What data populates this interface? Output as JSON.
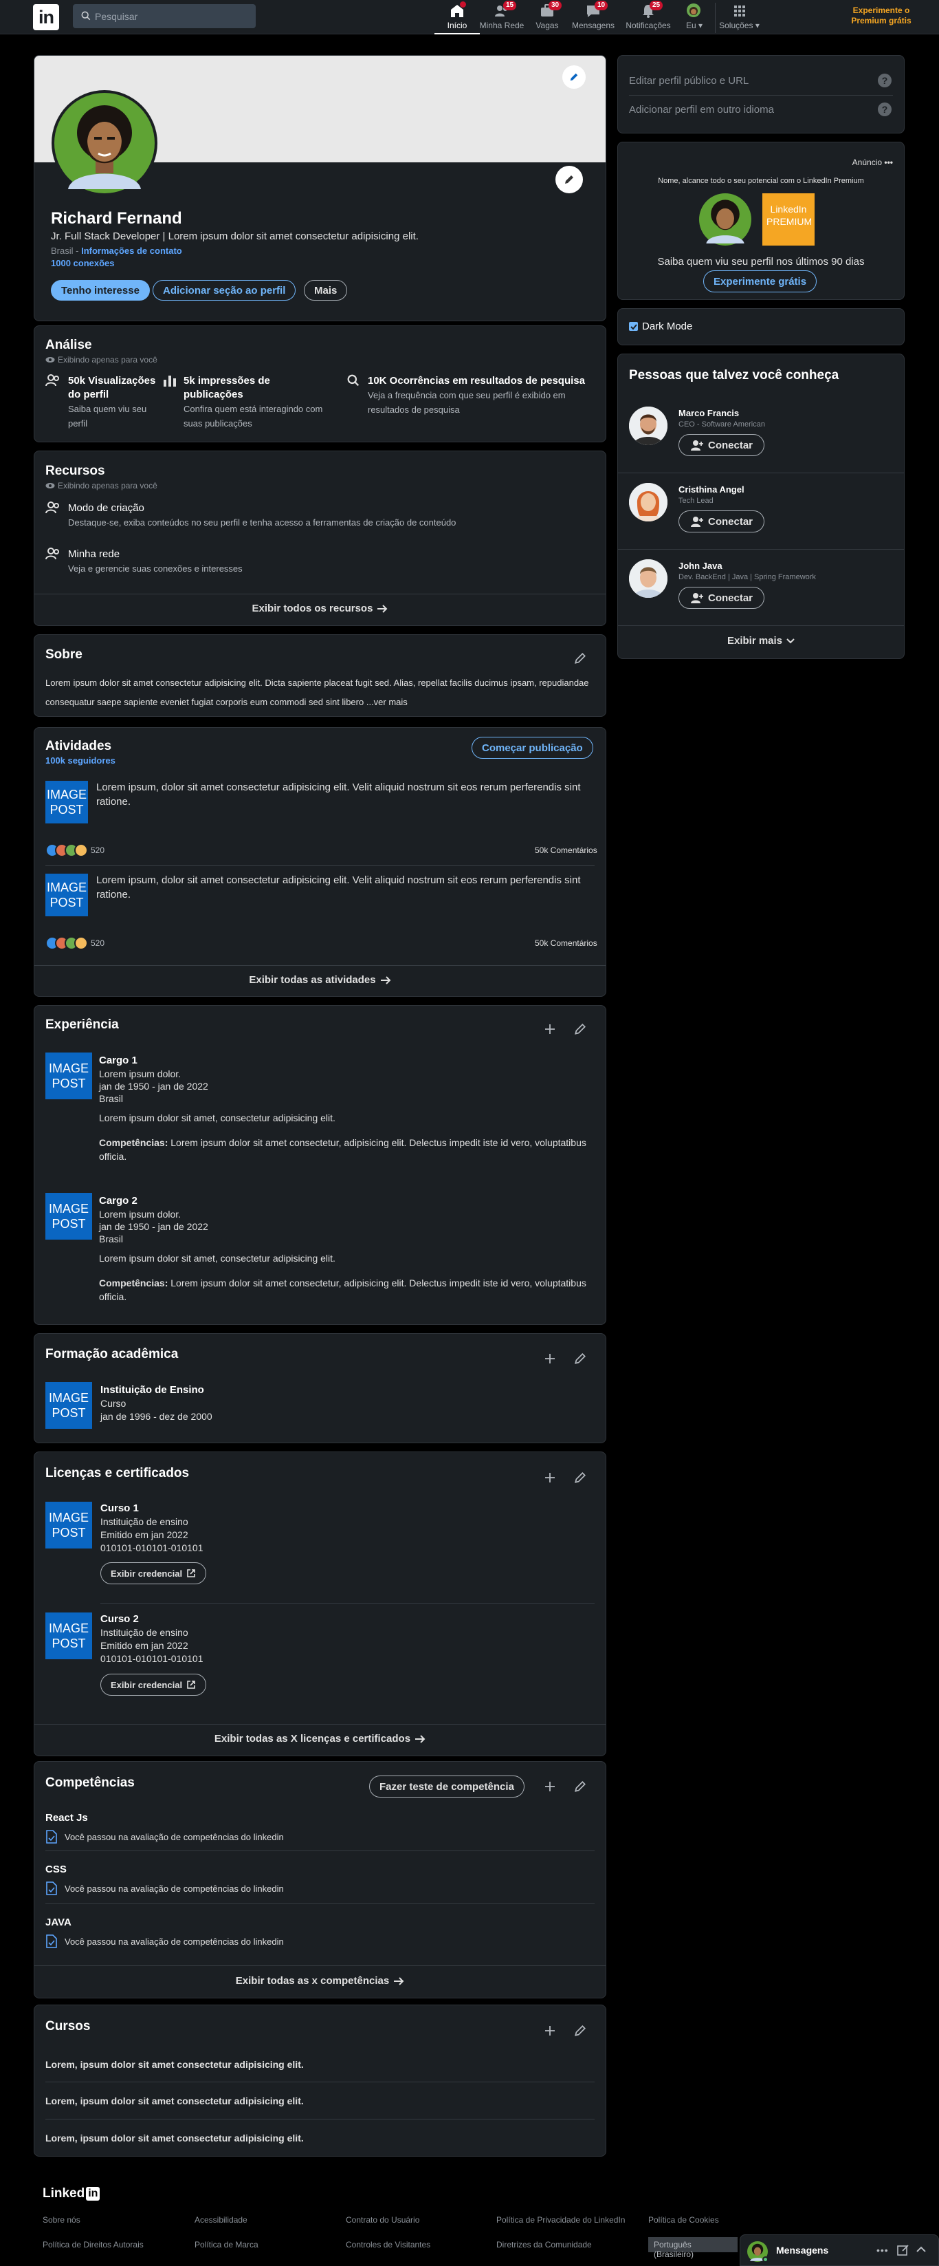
{
  "nav": {
    "logo": "in",
    "search_placeholder": "Pesquisar",
    "items": [
      {
        "label": "Início",
        "badge": ""
      },
      {
        "label": "Minha Rede",
        "badge": "15"
      },
      {
        "label": "Vagas",
        "badge": "30"
      },
      {
        "label": "Mensagens",
        "badge": "10"
      },
      {
        "label": "Notificações",
        "badge": "25"
      },
      {
        "label": "Eu ▾",
        "badge": ""
      },
      {
        "label": "Soluções ▾",
        "badge": ""
      }
    ],
    "promo": "Experimente o Premium grátis"
  },
  "profile": {
    "name": "Richard Fernand",
    "headline": "Jr. Full Stack Developer | Lorem ipsum dolor sit amet consectetur adipisicing elit.",
    "location": "Brasil",
    "sep": " - ",
    "contact_link": "Informações de contato",
    "connections": "1000 conexões",
    "btn_interest": "Tenho interesse",
    "btn_add_section": "Adicionar seção ao perfil",
    "btn_more": "Mais"
  },
  "analysis": {
    "title": "Análise",
    "private": "Exibindo apenas para você",
    "items": [
      {
        "title": "50k Visualizações do perfil",
        "desc": "Saiba quem viu seu perfil"
      },
      {
        "title": "5k impressões de publicações",
        "desc": "Confira quem está interagindo com suas publicações"
      },
      {
        "title": "10K Ocorrências em resultados de pesquisa",
        "desc": "Veja a frequência com que seu perfil é exibido em resultados de pesquisa"
      }
    ]
  },
  "resources": {
    "title": "Recursos",
    "private": "Exibindo apenas para você",
    "items": [
      {
        "title": "Modo de criação",
        "desc": "Destaque-se, exiba conteúdos no seu perfil e tenha acesso a ferramentas de criação de conteúdo"
      },
      {
        "title": "Minha rede",
        "desc": "Veja e gerencie suas conexões e interesses"
      }
    ],
    "footer": "Exibir todos os recursos"
  },
  "about": {
    "title": "Sobre",
    "text": "Lorem ipsum dolor sit amet consectetur adipisicing elit. Dicta sapiente placeat fugit sed. Alias, repellat facilis ducimus ipsam, repudiandae consequatur saepe sapiente eveniet fugiat corporis eum commodi sed sint libero ",
    "more": "...ver mais"
  },
  "activities": {
    "title": "Atividades",
    "followers": "100k seguidores",
    "btn": "Começar publicação",
    "image_text": "IMAGE POST",
    "posts": [
      {
        "text": "Lorem ipsum, dolor sit amet consectetur adipisicing elit. Velit aliquid nostrum sit eos rerum perferendis sint ratione.",
        "reactions": "520",
        "comments": "50k Comentários"
      },
      {
        "text": "Lorem ipsum, dolor sit amet consectetur adipisicing elit. Velit aliquid nostrum sit eos rerum perferendis sint ratione.",
        "reactions": "520",
        "comments": "50k Comentários"
      }
    ],
    "footer": "Exibir todas as atividades"
  },
  "experience": {
    "title": "Experiência",
    "image_text": "IMAGE POST",
    "items": [
      {
        "role": "Cargo 1",
        "company": "Lorem ipsum dolor.",
        "dates": "jan de 1950 - jan de 2022",
        "place": "Brasil",
        "desc": "Lorem ipsum dolor sit amet, consectetur adipisicing elit.",
        "skills_label": "Competências:",
        "skills": " Lorem ipsum dolor sit amet consectetur, adipisicing elit. Delectus impedit iste id vero, voluptatibus officia."
      },
      {
        "role": "Cargo 2",
        "company": "Lorem ipsum dolor.",
        "dates": "jan de 1950 - jan de 2022",
        "place": "Brasil",
        "desc": "Lorem ipsum dolor sit amet, consectetur adipisicing elit.",
        "skills_label": "Competências:",
        "skills": " Lorem ipsum dolor sit amet consectetur, adipisicing elit. Delectus impedit iste id vero, voluptatibus officia."
      }
    ]
  },
  "education": {
    "title": "Formação acadêmica",
    "image_text": "IMAGE POST",
    "school": "Instituição de Ensino",
    "course": "Curso",
    "dates": "jan de 1996 - dez de 2000"
  },
  "licenses": {
    "title": "Licenças e certificados",
    "image_text": "IMAGE POST",
    "items": [
      {
        "name": "Curso 1",
        "issuer": "Instituição de ensino",
        "issued": "Emitido em jan 2022",
        "code": "010101-010101-010101",
        "btn": "Exibir credencial"
      },
      {
        "name": "Curso 2",
        "issuer": "Instituição de ensino",
        "issued": "Emitido em jan 2022",
        "code": "010101-010101-010101",
        "btn": "Exibir credencial"
      }
    ],
    "footer": "Exibir todas as X licenças e certificados"
  },
  "skills": {
    "title": "Competências",
    "btn": "Fazer teste de competência",
    "items": [
      {
        "name": "React Js",
        "desc": "Você passou na avaliação de competências do linkedin"
      },
      {
        "name": "CSS",
        "desc": "Você passou na avaliação de competências do linkedin"
      },
      {
        "name": "JAVA",
        "desc": "Você passou na avaliação de competências do linkedin"
      }
    ],
    "footer": "Exibir todas as x competências"
  },
  "courses": {
    "title": "Cursos",
    "items": [
      "Lorem, ipsum dolor sit amet consectetur adipisicing elit.",
      "Lorem, ipsum dolor sit amet consectetur adipisicing elit.",
      "Lorem, ipsum dolor sit amet consectetur adipisicing elit."
    ]
  },
  "sidebar": {
    "edit_url": "Editar perfil público e URL",
    "add_language": "Adicionar perfil em outro idioma",
    "ad": {
      "label": "Anúncio",
      "dots": "•••",
      "text": "Nome, alcance todo o seu potencial com o LinkedIn Premium",
      "premium_logo": "LinkedIn PREMIUM",
      "headline": "Saiba quem viu seu perfil nos últimos 90 dias",
      "btn": "Experimente grátis"
    },
    "dark_mode": "Dark Mode",
    "people": {
      "title": "Pessoas que talvez você conheça",
      "btn": "Conectar",
      "list": [
        {
          "name": "Marco Francis",
          "role": "CEO - Software American"
        },
        {
          "name": "Cristhina Angel",
          "role": "Tech Lead"
        },
        {
          "name": "John Java",
          "role": "Dev. BackEnd | Java | Spring Framework"
        }
      ],
      "more": "Exibir mais"
    }
  },
  "footer": {
    "logo_text": "Linked",
    "logo_in": "in",
    "links": [
      "Sobre nós",
      "Acessibilidade",
      "Contrato do Usuário",
      "Política de Privacidade do LinkedIn",
      "Política de Cookies",
      "Política de Direitos Autorais",
      "Política de Marca",
      "Controles de Visitantes",
      "Diretrizes da Comunidade"
    ],
    "language": "Português (Brasileiro)"
  },
  "messaging": {
    "label": "Mensagens"
  },
  "colors": {
    "background": "#000000",
    "card": "#1b1f23",
    "accent": "#70b5f9",
    "brand": "#0a66c2",
    "premium": "#f5a623"
  }
}
